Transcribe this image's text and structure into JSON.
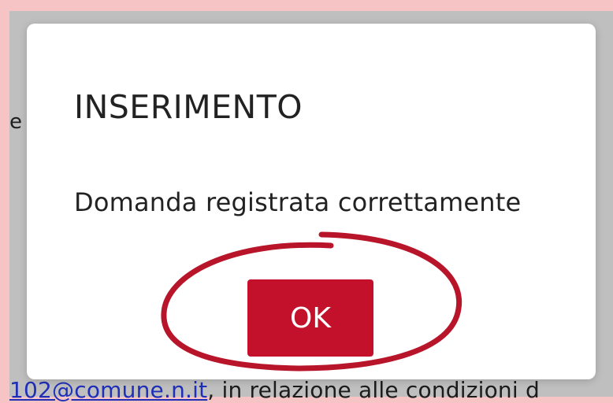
{
  "background": {
    "partial_text": "e",
    "bottom_link_text": "102@comune.n.it",
    "bottom_text": ", in relazione alle condizioni d"
  },
  "modal": {
    "title": "INSERIMENTO",
    "message": "Domanda registrata correttamente",
    "ok_label": "OK"
  },
  "colors": {
    "frame": "#f7c4c6",
    "button": "#c3112b",
    "annotation": "#b8152a",
    "link": "#1f2fb8"
  }
}
